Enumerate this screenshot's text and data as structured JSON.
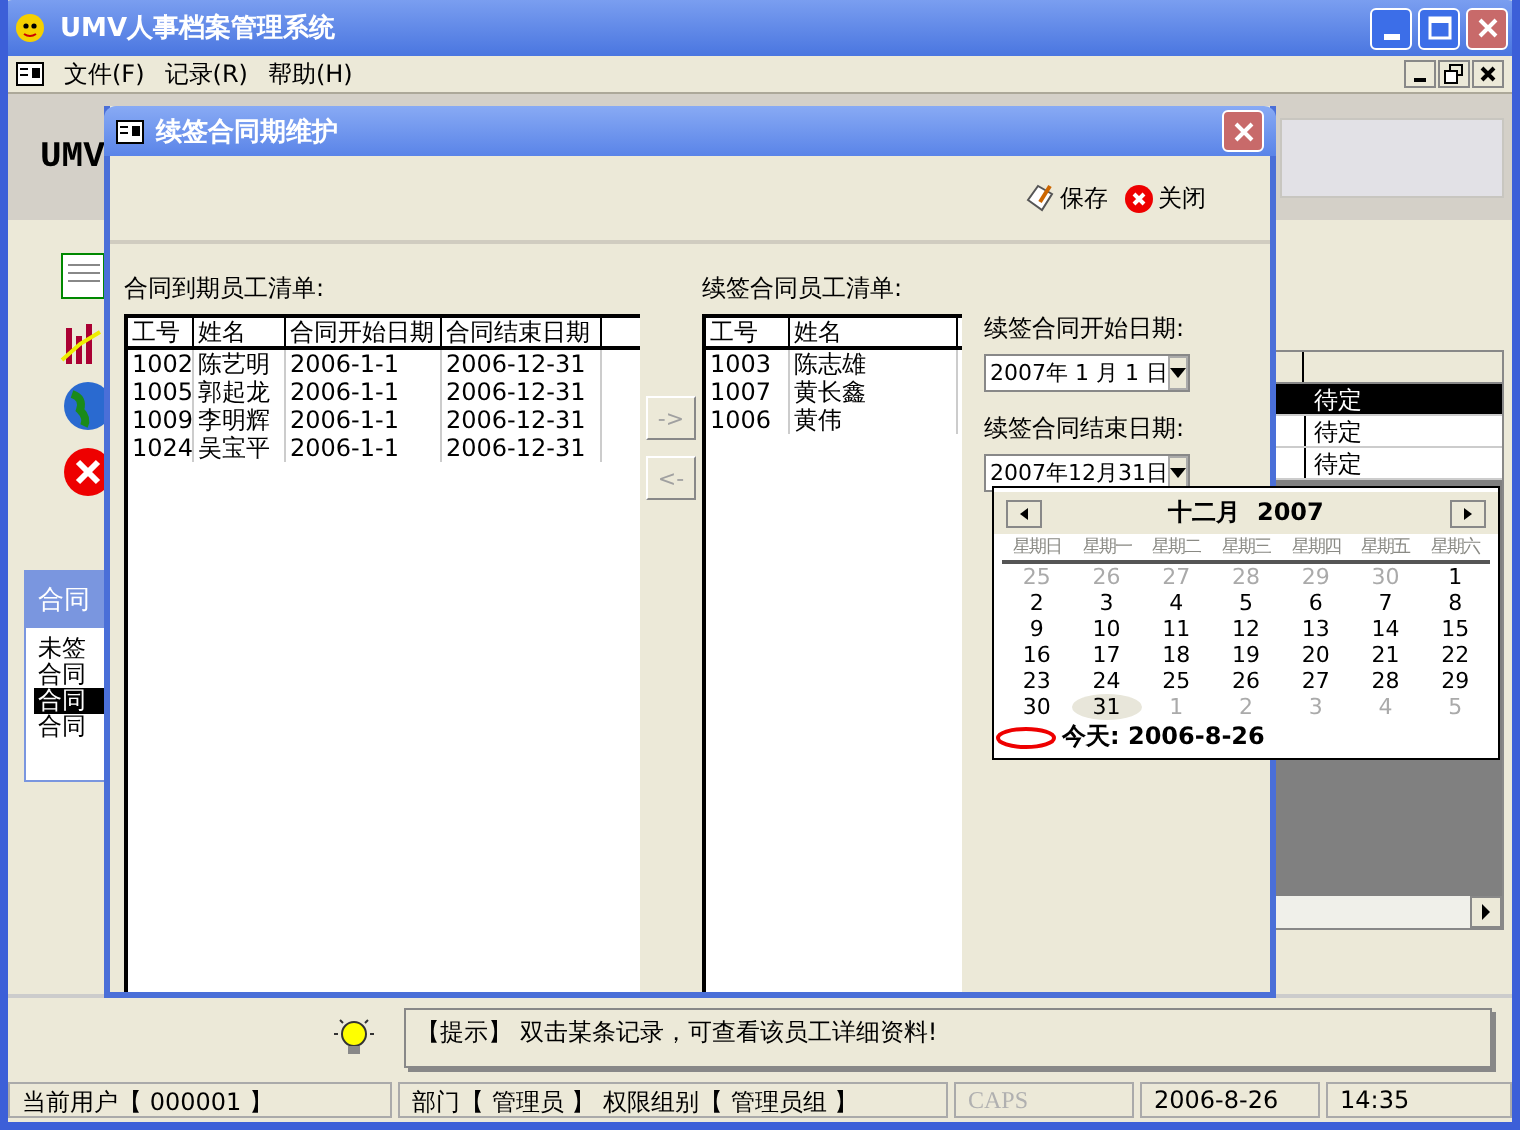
{
  "window": {
    "title": "UMV人事档案管理系统"
  },
  "menu": [
    "文件(F)",
    "记录(R)",
    "帮助(H)"
  ],
  "background": {
    "header": "UMV",
    "panel": {
      "title": "合同",
      "items": [
        {
          "label": "未签",
          "selected": false
        },
        {
          "label": "合同",
          "selected": false
        },
        {
          "label": "合同",
          "selected": true
        },
        {
          "label": "合同",
          "selected": false
        }
      ]
    },
    "table_rows": [
      {
        "cell": "待定",
        "selected": true
      },
      {
        "cell": "待定",
        "selected": false
      },
      {
        "cell": "待定",
        "selected": false
      }
    ]
  },
  "dialog": {
    "title": "续签合同期维护",
    "toolbar": [
      {
        "kind": "save",
        "label": "保存"
      },
      {
        "kind": "close",
        "label": "关闭"
      }
    ],
    "expiring": {
      "label": "合同到期员工清单:",
      "columns": [
        "工号",
        "姓名",
        "合同开始日期",
        "合同结束日期"
      ],
      "rows": [
        [
          "1002",
          "陈艺明",
          "2006-1-1",
          "2006-12-31"
        ],
        [
          "1005",
          "郭起龙",
          "2006-1-1",
          "2006-12-31"
        ],
        [
          "1009",
          "李明辉",
          "2006-1-1",
          "2006-12-31"
        ],
        [
          "1024",
          "吴宝平",
          "2006-1-1",
          "2006-12-31"
        ]
      ]
    },
    "transfer": [
      {
        "label": "->",
        "disabled": true
      },
      {
        "label": "<-",
        "disabled": true
      }
    ],
    "renewing": {
      "label": "续签合同员工清单:",
      "columns": [
        "工号",
        "姓名"
      ],
      "rows": [
        [
          "1003",
          "陈志雄"
        ],
        [
          "1007",
          "黄长鑫"
        ],
        [
          "1006",
          "黄伟"
        ]
      ]
    },
    "start_date": {
      "label": "续签合同开始日期:",
      "value": "2007年 1 月 1 日"
    },
    "end_date": {
      "label": "续签合同结束日期:",
      "value": "2007年12月31日"
    },
    "calendar": {
      "title": "十二月  2007",
      "weekdays": [
        "星期日",
        "星期一",
        "星期二",
        "星期三",
        "星期四",
        "星期五",
        "星期六"
      ],
      "weeks": [
        [
          {
            "day": "25",
            "kind": "other",
            "selected": false
          },
          {
            "day": "26",
            "kind": "other",
            "selected": false
          },
          {
            "day": "27",
            "kind": "other",
            "selected": false
          },
          {
            "day": "28",
            "kind": "other",
            "selected": false
          },
          {
            "day": "29",
            "kind": "other",
            "selected": false
          },
          {
            "day": "30",
            "kind": "other",
            "selected": false
          },
          {
            "day": "1",
            "kind": "current",
            "selected": false
          }
        ],
        [
          {
            "day": "2",
            "kind": "current",
            "selected": false
          },
          {
            "day": "3",
            "kind": "current",
            "selected": false
          },
          {
            "day": "4",
            "kind": "current",
            "selected": false
          },
          {
            "day": "5",
            "kind": "current",
            "selected": false
          },
          {
            "day": "6",
            "kind": "current",
            "selected": false
          },
          {
            "day": "7",
            "kind": "current",
            "selected": false
          },
          {
            "day": "8",
            "kind": "current",
            "selected": false
          }
        ],
        [
          {
            "day": "9",
            "kind": "current",
            "selected": false
          },
          {
            "day": "10",
            "kind": "current",
            "selected": false
          },
          {
            "day": "11",
            "kind": "current",
            "selected": false
          },
          {
            "day": "12",
            "kind": "current",
            "selected": false
          },
          {
            "day": "13",
            "kind": "current",
            "selected": false
          },
          {
            "day": "14",
            "kind": "current",
            "selected": false
          },
          {
            "day": "15",
            "kind": "current",
            "selected": false
          }
        ],
        [
          {
            "day": "16",
            "kind": "current",
            "selected": false
          },
          {
            "day": "17",
            "kind": "current",
            "selected": false
          },
          {
            "day": "18",
            "kind": "current",
            "selected": false
          },
          {
            "day": "19",
            "kind": "current",
            "selected": false
          },
          {
            "day": "20",
            "kind": "current",
            "selected": false
          },
          {
            "day": "21",
            "kind": "current",
            "selected": false
          },
          {
            "day": "22",
            "kind": "current",
            "selected": false
          }
        ],
        [
          {
            "day": "23",
            "kind": "current",
            "selected": false
          },
          {
            "day": "24",
            "kind": "current",
            "selected": false
          },
          {
            "day": "25",
            "kind": "current",
            "selected": false
          },
          {
            "day": "26",
            "kind": "current",
            "selected": false
          },
          {
            "day": "27",
            "kind": "current",
            "selected": false
          },
          {
            "day": "28",
            "kind": "current",
            "selected": false
          },
          {
            "day": "29",
            "kind": "current",
            "selected": false
          }
        ],
        [
          {
            "day": "30",
            "kind": "current",
            "selected": false
          },
          {
            "day": "31",
            "kind": "current",
            "selected": true
          },
          {
            "day": "1",
            "kind": "other",
            "selected": false
          },
          {
            "day": "2",
            "kind": "other",
            "selected": false
          },
          {
            "day": "3",
            "kind": "other",
            "selected": false
          },
          {
            "day": "4",
            "kind": "other",
            "selected": false
          },
          {
            "day": "5",
            "kind": "other",
            "selected": false
          }
        ]
      ],
      "today": "今天: 2006-8-26"
    }
  },
  "hint": "【提示】 双击某条记录，可查看该员工详细资料!",
  "status_bar": [
    {
      "text": "当前用户【 000001 】",
      "disabled": false
    },
    {
      "text": "部门【 管理员 】 权限组别【 管理员组 】",
      "disabled": false
    },
    {
      "text": "CAPS",
      "disabled": true
    },
    {
      "text": "2006-8-26",
      "disabled": false
    },
    {
      "text": "14:35",
      "disabled": false
    }
  ]
}
